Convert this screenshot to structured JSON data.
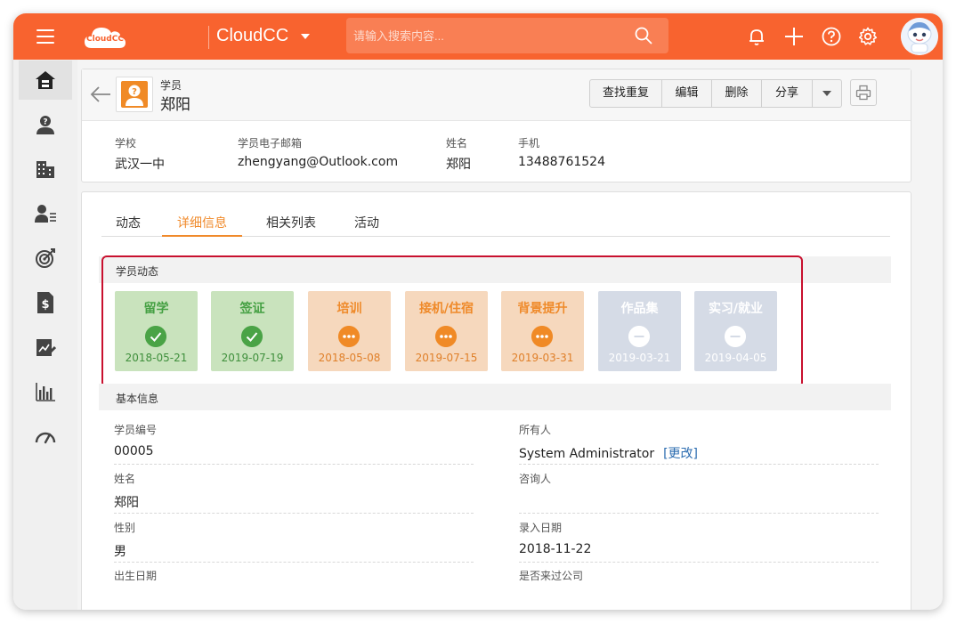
{
  "topbar": {
    "logo_text": "CloudCC",
    "app_name": "CloudCC",
    "search_placeholder": "请输入搜索内容..."
  },
  "record": {
    "type": "学员",
    "name": "郑阳",
    "buttons": [
      "查找重复",
      "编辑",
      "删除",
      "分享"
    ],
    "highlights": [
      {
        "label": "学校",
        "value": "武汉一中"
      },
      {
        "label": "学员电子邮箱",
        "value": "zhengyang@Outlook.com"
      },
      {
        "label": "姓名",
        "value": "郑阳"
      },
      {
        "label": "手机",
        "value": "13488761524"
      }
    ]
  },
  "tabs": [
    "动态",
    "详细信息",
    "相关列表",
    "活动"
  ],
  "active_tab": "详细信息",
  "status_section": {
    "title": "学员动态",
    "steps": [
      {
        "title": "留学",
        "date": "2018-05-21",
        "state": "done"
      },
      {
        "title": "签证",
        "date": "2019-07-19",
        "state": "done"
      },
      {
        "title": "培训",
        "date": "2018-05-08",
        "state": "in-progress"
      },
      {
        "title": "接机/住宿",
        "date": "2019-07-15",
        "state": "in-progress"
      },
      {
        "title": "背景提升",
        "date": "2019-03-31",
        "state": "in-progress"
      },
      {
        "title": "作品集",
        "date": "2019-03-21",
        "state": "not-started"
      },
      {
        "title": "实习/就业",
        "date": "2019-04-05",
        "state": "not-started"
      }
    ]
  },
  "basic_section": {
    "title": "基本信息",
    "left": [
      {
        "label": "学员编号",
        "value": "00005"
      },
      {
        "label": "姓名",
        "value": "郑阳"
      },
      {
        "label": "性别",
        "value": "男"
      },
      {
        "label": "出生日期",
        "value": ""
      }
    ],
    "right": [
      {
        "label": "所有人",
        "value": "System Administrator",
        "link": "[更改]"
      },
      {
        "label": "咨询人",
        "value": ""
      },
      {
        "label": "录入日期",
        "value": "2018-11-22"
      },
      {
        "label": "是否来过公司",
        "value": ""
      }
    ]
  },
  "colors": {
    "brand": "#f8632f",
    "done": "#4aa346",
    "in_progress": "#f08a26",
    "not_started": "#d5dbe6",
    "highlight_border": "#c8102e"
  }
}
